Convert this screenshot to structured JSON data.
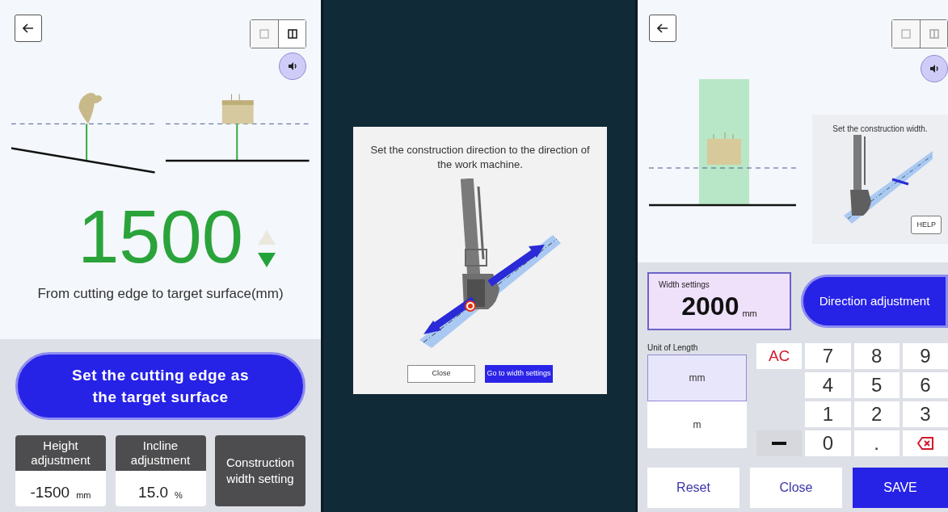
{
  "left_screen": {
    "view_toggle": [
      {
        "kind": "single",
        "selected": false
      },
      {
        "kind": "split",
        "selected": true
      }
    ],
    "distance": {
      "value": "1500",
      "caption": "From cutting edge to target surface(mm)"
    },
    "primary_button": "Set the cutting edge as the target surface",
    "tiles": [
      {
        "kind": "value",
        "label": "Height adjustment",
        "value": "-1500",
        "unit": "mm"
      },
      {
        "kind": "value",
        "label": "Incline adjustment",
        "value": "15.0",
        "unit": "%"
      },
      {
        "kind": "action",
        "label": "Construction width setting"
      }
    ]
  },
  "middle_screen": {
    "dialog": {
      "message": "Set the construction direction to the direction of the work machine.",
      "buttons": [
        {
          "kind": "secondary",
          "label": "Close"
        },
        {
          "kind": "primary",
          "label": "Go to width settings"
        }
      ]
    }
  },
  "right_screen": {
    "view_toggle": [
      {
        "kind": "single",
        "selected": false
      },
      {
        "kind": "split",
        "selected": false
      }
    ],
    "help_card": {
      "text": "Set the construction width.",
      "button": "HELP"
    },
    "width_field": {
      "label": "Width settings",
      "value": "2000",
      "unit": "mm"
    },
    "direction_button": "Direction adjustment",
    "unit_label": "Unit of Length",
    "units": [
      {
        "label": "mm",
        "selected": true
      },
      {
        "label": "m",
        "selected": false
      }
    ],
    "keys": [
      {
        "kind": "clear",
        "label": "AC"
      },
      {
        "kind": "digit",
        "label": "7"
      },
      {
        "kind": "digit",
        "label": "8"
      },
      {
        "kind": "digit",
        "label": "9"
      },
      {
        "kind": "empty"
      },
      {
        "kind": "digit",
        "label": "4"
      },
      {
        "kind": "digit",
        "label": "5"
      },
      {
        "kind": "digit",
        "label": "6"
      },
      {
        "kind": "empty"
      },
      {
        "kind": "digit",
        "label": "1"
      },
      {
        "kind": "digit",
        "label": "2"
      },
      {
        "kind": "digit",
        "label": "3"
      },
      {
        "kind": "minus"
      },
      {
        "kind": "digit",
        "label": "0"
      },
      {
        "kind": "digit",
        "label": "."
      },
      {
        "kind": "backspace"
      }
    ],
    "footer_buttons": [
      {
        "kind": "secondary",
        "label": "Reset"
      },
      {
        "kind": "secondary",
        "label": "Close"
      },
      {
        "kind": "primary",
        "label": "SAVE"
      }
    ]
  }
}
